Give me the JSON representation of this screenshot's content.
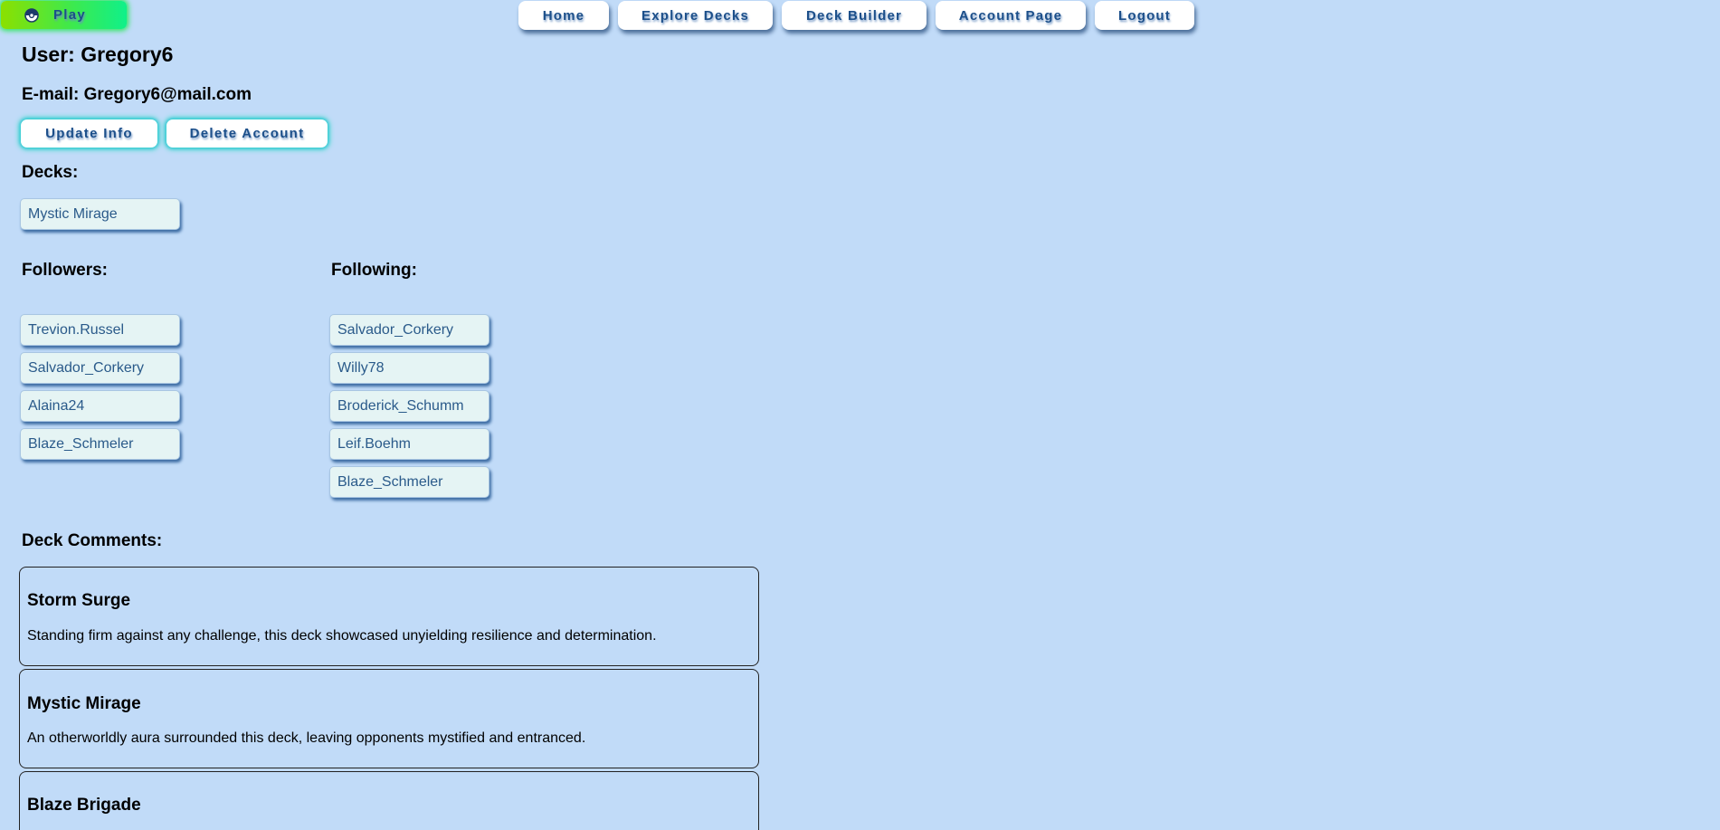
{
  "nav": {
    "play_label": "Play",
    "play_icon": "pokeball-icon",
    "items": [
      "Home",
      "Explore Decks",
      "Deck Builder",
      "Account Page",
      "Logout"
    ]
  },
  "profile": {
    "user_line": "User: Gregory6",
    "email_line": "E-mail: Gregory6@mail.com",
    "update_label": "Update Info",
    "delete_label": "Delete Account"
  },
  "decks": {
    "heading": "Decks:",
    "items": [
      "Mystic Mirage"
    ]
  },
  "followers": {
    "heading": "Followers:",
    "items": [
      "Trevion.Russel",
      "Salvador_Corkery",
      "Alaina24",
      "Blaze_Schmeler"
    ]
  },
  "following": {
    "heading": "Following:",
    "items": [
      "Salvador_Corkery",
      "Willy78",
      "Broderick_Schumm",
      "Leif.Boehm",
      "Blaze_Schmeler"
    ]
  },
  "comments": {
    "heading": "Deck Comments:",
    "items": [
      {
        "title": "Storm Surge",
        "text": "Standing firm against any challenge, this deck showcased unyielding resilience and determination."
      },
      {
        "title": "Mystic Mirage",
        "text": "An otherworldly aura surrounded this deck, leaving opponents mystified and entranced."
      },
      {
        "title": "Blaze Brigade",
        "text": ""
      }
    ]
  },
  "colors": {
    "background": "#c1dbf8",
    "button_text": "#1c4f8a",
    "chip_bg": "#e5f4f4",
    "play_gradient_start": "#8be000",
    "play_gradient_end": "#10f08a"
  }
}
